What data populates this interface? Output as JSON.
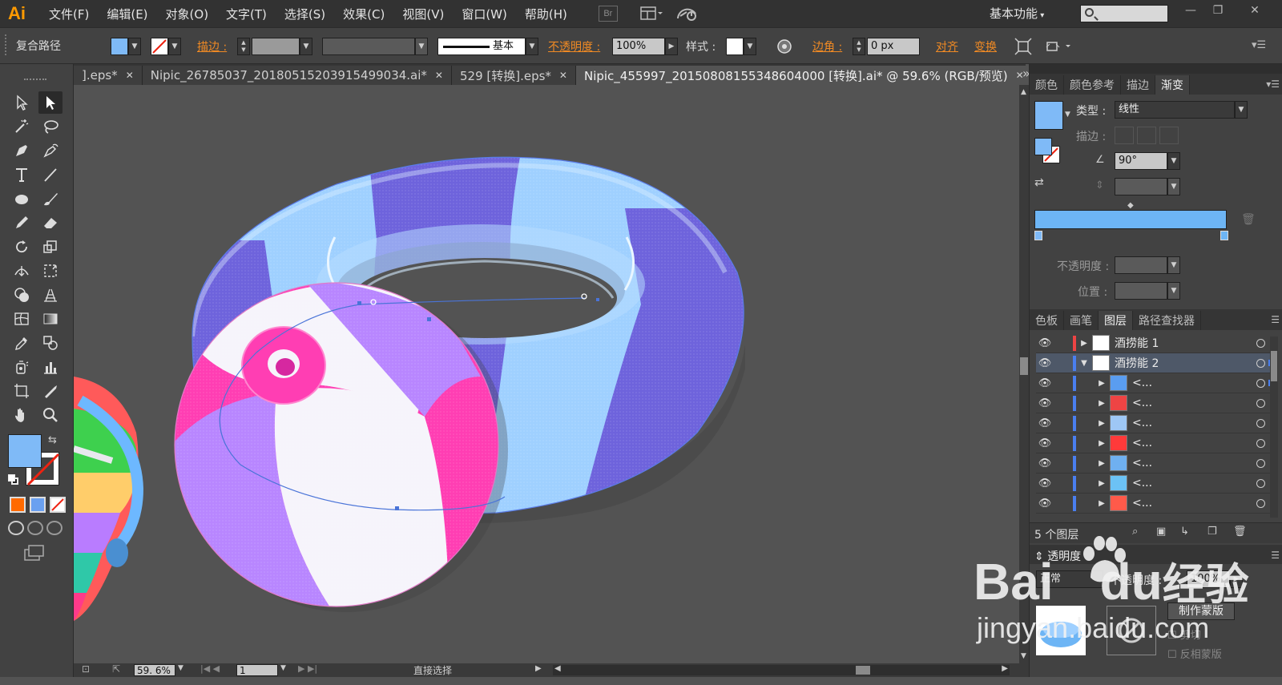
{
  "app": {
    "logo": "Ai"
  },
  "menu": [
    "文件(F)",
    "编辑(E)",
    "对象(O)",
    "文字(T)",
    "选择(S)",
    "效果(C)",
    "视图(V)",
    "窗口(W)",
    "帮助(H)"
  ],
  "bridge_label": "Br",
  "workspace": "基本功能",
  "window_controls": [
    "—",
    "❐",
    "✕"
  ],
  "control_bar": {
    "selection_type": "复合路径",
    "stroke_label": "描边 :",
    "stroke_style": "基本",
    "opacity_label": "不透明度 :",
    "opacity_value": "100%",
    "style_label": "样式 :",
    "corner_label": "边角 :",
    "corner_value": "0 px",
    "align_label": "对齐",
    "transform_label": "变换"
  },
  "tabs": [
    {
      "label": "].eps*",
      "close": "✕"
    },
    {
      "label": "Nipic_26785037_20180515203915499034.ai*",
      "close": "✕"
    },
    {
      "label": "529 [转换].eps*",
      "close": "✕"
    },
    {
      "label": "Nipic_455997_20150808155348604000 [转换].ai* @ 59.6% (RGB/预览)",
      "close": "✕",
      "active": true
    }
  ],
  "tab_overflow": "»",
  "status": {
    "zoom": "59. 6%",
    "artboard": "1",
    "tool": "直接选择"
  },
  "gradient_panel": {
    "tabs": [
      "颜色",
      "颜色参考",
      "描边",
      "渐变"
    ],
    "active_tab": "渐变",
    "type_label": "类型 :",
    "type_value": "线性",
    "stroke_label": "描边 :",
    "angle_value": "90°",
    "opacity_label": "不透明度 :",
    "location_label": "位置 :",
    "gradient_color": "#6db5f5"
  },
  "layers_panel": {
    "tabs": [
      "色板",
      "画笔",
      "图层",
      "路径查找器"
    ],
    "active_tab": "图层",
    "layers": [
      {
        "name": "酒捞能 1",
        "expanded": false,
        "sublayer": false,
        "color": "#e44"
      },
      {
        "name": "酒捞能 2",
        "expanded": true,
        "sublayer": false,
        "color": "#4a7ff0",
        "selected": true
      },
      {
        "name": "<...",
        "sublayer": true,
        "color": "#4a7ff0",
        "target": true
      },
      {
        "name": "<...",
        "sublayer": true,
        "color": "#4a7ff0"
      },
      {
        "name": "<...",
        "sublayer": true,
        "color": "#4a7ff0"
      },
      {
        "name": "<...",
        "sublayer": true,
        "color": "#4a7ff0"
      },
      {
        "name": "<...",
        "sublayer": true,
        "color": "#4a7ff0"
      },
      {
        "name": "<...",
        "sublayer": true,
        "color": "#4a7ff0"
      },
      {
        "name": "<...",
        "sublayer": true,
        "color": "#4a7ff0"
      }
    ],
    "count_label": "5 个图层"
  },
  "transparency_panel": {
    "title": "透明度",
    "blend_mode": "正常",
    "opacity_label": "不透明度 :",
    "opacity_value": "100%",
    "make_mask": "制作蒙版",
    "clip": "剪切",
    "invert_mask": "反相蒙版"
  },
  "watermark": {
    "brand": "Bai",
    "du": "du",
    "jingyan": "经验",
    "url": "jingyan.baidu.com"
  },
  "colors": {
    "fill": "#7fbaf7",
    "ring_light": "#9fd0ff",
    "ring_dark": "#6e63dc",
    "ball_pink": "#ff3eb3",
    "ball_purple": "#b886ff",
    "ball_white": "#f6f4fb"
  }
}
